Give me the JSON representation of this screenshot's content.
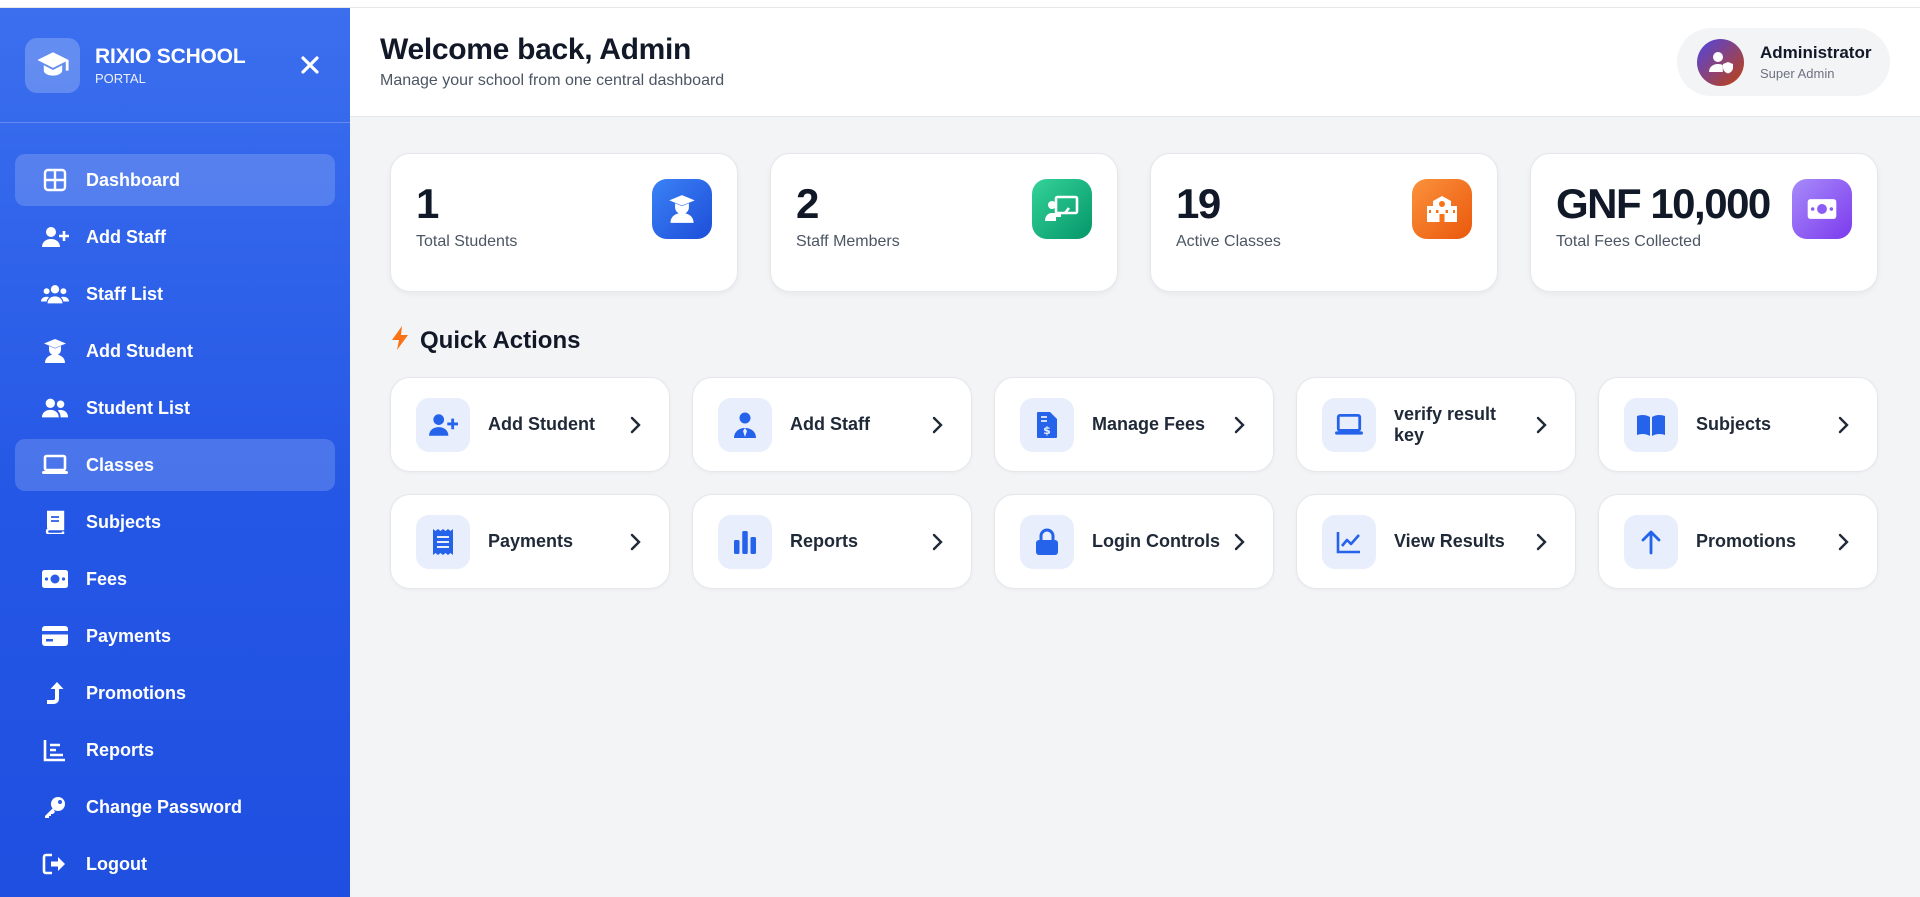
{
  "sidebar": {
    "brand": {
      "name": "RIXIO SCHOOL",
      "subtitle": "PORTAL",
      "logo_icon": "graduation-cap-icon",
      "close_icon": "close-icon"
    },
    "items": [
      {
        "label": "Dashboard",
        "icon": "grid-icon",
        "active": true
      },
      {
        "label": "Add Staff",
        "icon": "user-plus-icon",
        "active": false
      },
      {
        "label": "Staff List",
        "icon": "users-icon",
        "active": false
      },
      {
        "label": "Add Student",
        "icon": "graduate-icon",
        "active": false
      },
      {
        "label": "Student List",
        "icon": "user-group-icon",
        "active": false
      },
      {
        "label": "Classes",
        "icon": "laptop-icon",
        "active": true
      },
      {
        "label": "Subjects",
        "icon": "book-icon",
        "active": false
      },
      {
        "label": "Fees",
        "icon": "money-icon",
        "active": false
      },
      {
        "label": "Payments",
        "icon": "credit-card-icon",
        "active": false
      },
      {
        "label": "Promotions",
        "icon": "level-up-icon",
        "active": false
      },
      {
        "label": "Reports",
        "icon": "chart-icon",
        "active": false
      },
      {
        "label": "Change Password",
        "icon": "key-icon",
        "active": false
      },
      {
        "label": "Logout",
        "icon": "logout-icon",
        "active": false
      }
    ]
  },
  "header": {
    "title": "Welcome back, Admin",
    "subtitle": "Manage your school from one central dashboard",
    "user": {
      "name": "Administrator",
      "role": "Super Admin",
      "avatar_icon": "user-shield-icon"
    }
  },
  "stats": [
    {
      "value": "1",
      "label": "Total Students",
      "icon": "graduate-icon",
      "color": "#2563eb"
    },
    {
      "value": "2",
      "label": "Staff Members",
      "icon": "chalkboard-teacher-icon",
      "color": "#10b981"
    },
    {
      "value": "19",
      "label": "Active Classes",
      "icon": "school-icon",
      "color": "#f97316"
    },
    {
      "value": "GNF 10,000",
      "label": "Total Fees Collected",
      "icon": "money-icon",
      "color": "#8b5cf6"
    }
  ],
  "quick_actions": {
    "title": "Quick Actions",
    "title_icon": "bolt-icon",
    "items": [
      {
        "label": "Add Student",
        "icon": "user-plus-icon"
      },
      {
        "label": "Add Staff",
        "icon": "user-tie-icon"
      },
      {
        "label": "Manage Fees",
        "icon": "invoice-dollar-icon"
      },
      {
        "label": "verify result key",
        "icon": "laptop-icon"
      },
      {
        "label": "Subjects",
        "icon": "book-open-icon"
      },
      {
        "label": "Payments",
        "icon": "receipt-icon"
      },
      {
        "label": "Reports",
        "icon": "bar-chart-icon"
      },
      {
        "label": "Login Controls",
        "icon": "lock-icon"
      },
      {
        "label": "View Results",
        "icon": "line-chart-icon"
      },
      {
        "label": "Promotions",
        "icon": "arrow-up-icon"
      }
    ]
  },
  "colors": {
    "primary": "#2563eb",
    "sidebar": "#2557e6",
    "success": "#10b981",
    "warning": "#f97316",
    "purple": "#8b5cf6",
    "bolt": "#f97316"
  }
}
